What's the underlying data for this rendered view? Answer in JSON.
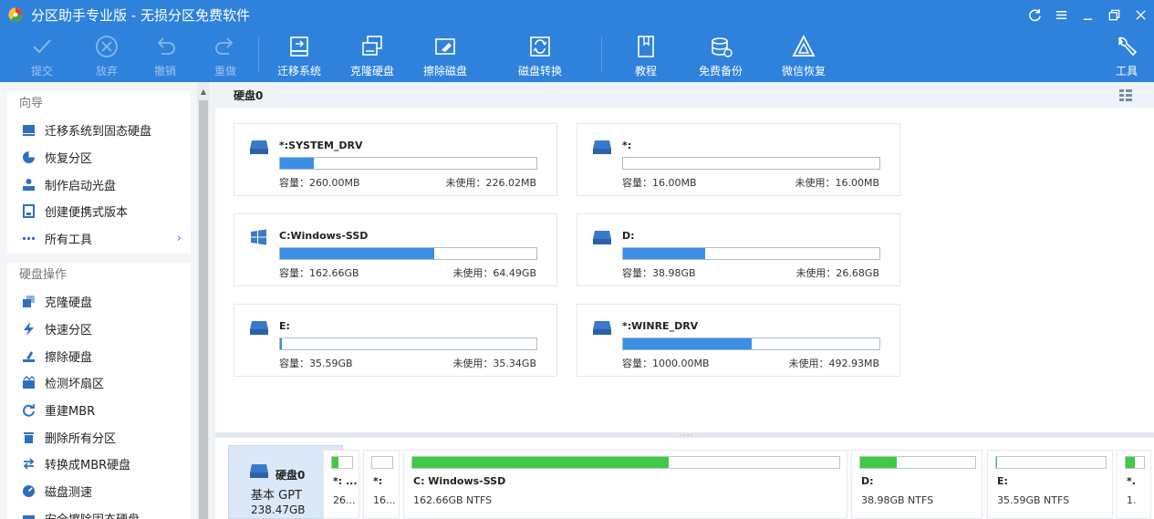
{
  "window": {
    "title": "分区助手专业版 - 无损分区免费软件",
    "colors": {
      "accent": "#2f82dc",
      "bar_fill": "#3a8ee6",
      "map_fill": "#42c944"
    }
  },
  "toolbar": {
    "items": [
      {
        "label": "提交",
        "icon": "check-icon",
        "enabled": false
      },
      {
        "label": "放弃",
        "icon": "discard-icon",
        "enabled": false
      },
      {
        "label": "撤销",
        "icon": "undo-icon",
        "enabled": false
      },
      {
        "label": "重做",
        "icon": "redo-icon",
        "enabled": false
      },
      {
        "label": "迁移系统",
        "icon": "migrate-os-icon",
        "enabled": true
      },
      {
        "label": "克隆硬盘",
        "icon": "clone-disk-icon",
        "enabled": true
      },
      {
        "label": "擦除磁盘",
        "icon": "wipe-disk-icon",
        "enabled": true
      },
      {
        "label": "磁盘转换",
        "icon": "disk-convert-icon",
        "enabled": true
      },
      {
        "label": "教程",
        "icon": "tutorial-icon",
        "enabled": true
      },
      {
        "label": "免费备份",
        "icon": "backup-icon",
        "enabled": true
      },
      {
        "label": "微信恢复",
        "icon": "wechat-recovery-icon",
        "enabled": true
      },
      {
        "label": "工具",
        "icon": "tools-icon",
        "enabled": true
      }
    ]
  },
  "sidebar": {
    "wizard": {
      "heading": "向导",
      "items": [
        {
          "label": "迁移系统到固态硬盘",
          "icon": "migrate-ssd-icon"
        },
        {
          "label": "恢复分区",
          "icon": "recover-partition-icon"
        },
        {
          "label": "制作启动光盘",
          "icon": "bootable-media-icon"
        },
        {
          "label": "创建便携式版本",
          "icon": "portable-version-icon"
        },
        {
          "label": "所有工具",
          "icon": "more-dots-icon",
          "arrow": "›"
        }
      ]
    },
    "disk_ops": {
      "heading": "硬盘操作",
      "items": [
        {
          "label": "克隆硬盘",
          "icon": "clone-disk-icon"
        },
        {
          "label": "快速分区",
          "icon": "quick-partition-icon"
        },
        {
          "label": "擦除硬盘",
          "icon": "wipe-disk-icon"
        },
        {
          "label": "检测坏扇区",
          "icon": "bad-sector-icon"
        },
        {
          "label": "重建MBR",
          "icon": "rebuild-mbr-icon"
        },
        {
          "label": "删除所有分区",
          "icon": "delete-partitions-icon"
        },
        {
          "label": "转换成MBR硬盘",
          "icon": "convert-mbr-icon"
        },
        {
          "label": "磁盘测速",
          "icon": "speed-test-icon"
        },
        {
          "label": "安全擦除固态硬盘",
          "icon": "secure-erase-icon"
        }
      ]
    }
  },
  "main": {
    "disk_title": "硬盘0",
    "partitions": [
      {
        "name": "*:SYSTEM_DRV",
        "icon": "drive-icon",
        "capacity": "容量：260.00MB",
        "free": "未使用：226.02MB",
        "used_fraction": 0.13
      },
      {
        "name": "*:",
        "icon": "drive-icon",
        "capacity": "容量：16.00MB",
        "free": "未使用：16.00MB",
        "used_fraction": 0.0
      },
      {
        "name": "C:Windows-SSD",
        "icon": "windows-logo-icon",
        "capacity": "容量：162.66GB",
        "free": "未使用：64.49GB",
        "used_fraction": 0.6
      },
      {
        "name": "D:",
        "icon": "drive-icon",
        "capacity": "容量：38.98GB",
        "free": "未使用：26.68GB",
        "used_fraction": 0.32
      },
      {
        "name": "E:",
        "icon": "drive-icon",
        "capacity": "容量：35.59GB",
        "free": "未使用：35.34GB",
        "used_fraction": 0.007
      },
      {
        "name": "*:WINRE_DRV",
        "icon": "drive-icon",
        "capacity": "容量：1000.00MB",
        "free": "未使用：492.93MB",
        "used_fraction": 0.5
      }
    ]
  },
  "diskmap": {
    "disk": {
      "name": "硬盘0",
      "type": "基本 GPT",
      "size": "238.47GB"
    },
    "blocks": [
      {
        "name": "*: ...",
        "info": "26...",
        "used_fraction": 0.3
      },
      {
        "name": "*:",
        "info": "16...",
        "used_fraction": 0.0
      },
      {
        "name": "C: Windows-SSD",
        "info": "162.66GB NTFS",
        "used_fraction": 0.6
      },
      {
        "name": "D:",
        "info": "38.98GB NTFS",
        "used_fraction": 0.32
      },
      {
        "name": "E:",
        "info": "35.59GB NTFS",
        "used_fraction": 0.01
      },
      {
        "name": "*.",
        "info": "1.",
        "used_fraction": 0.5
      }
    ]
  }
}
